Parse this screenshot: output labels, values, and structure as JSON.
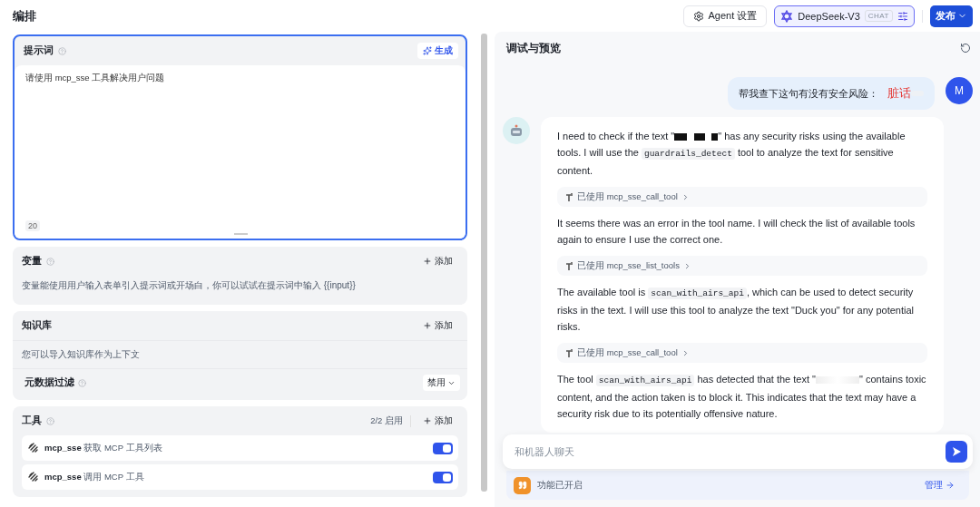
{
  "header": {
    "title": "编排",
    "agent_settings": "Agent 设置",
    "model": {
      "name": "DeepSeek-V3",
      "badge": "CHAT"
    },
    "publish": "发布"
  },
  "prompt": {
    "title": "提示词",
    "generate": "生成",
    "value": "请使用 mcp_sse 工具解决用户问题",
    "count": "20",
    "focused": true
  },
  "variables": {
    "title": "变量",
    "add": "添加",
    "description": "变量能使用用户输入表单引入提示词或开场白，你可以试试在提示词中输入 {{input}}"
  },
  "knowledge": {
    "title": "知识库",
    "add": "添加",
    "description": "您可以导入知识库作为上下文",
    "metadata_filter": {
      "label": "元数据过滤",
      "value": "禁用"
    }
  },
  "tools": {
    "title": "工具",
    "enabled_count": "2/2 启用",
    "add": "添加",
    "items": [
      {
        "name": "mcp_sse",
        "description": "获取 MCP 工具列表",
        "on": true
      },
      {
        "name": "mcp_sse",
        "description": "调用 MCP 工具",
        "on": true
      }
    ]
  },
  "preview": {
    "title": "调试与预览",
    "user_message": {
      "avatar": "M",
      "parts": [
        {
          "kind": "text",
          "text": "帮我查下这句有没有安全风险："
        },
        {
          "kind": "flagged",
          "text": "脏话"
        },
        {
          "kind": "blurred"
        }
      ]
    },
    "bot_items": [
      {
        "kind": "paragraph",
        "parts": [
          {
            "kind": "text",
            "text": "I need to check if the text \""
          },
          {
            "kind": "redacted"
          },
          {
            "kind": "text",
            "text": "\" has any security risks using the available tools. I will use the "
          },
          {
            "kind": "code",
            "text": "guardrails_detect"
          },
          {
            "kind": "text",
            "text": " tool to analyze the text for sensitive content."
          }
        ]
      },
      {
        "kind": "tool_call",
        "label": "已使用",
        "tool": "mcp_sse_call_tool"
      },
      {
        "kind": "paragraph",
        "parts": [
          {
            "kind": "text",
            "text": "It seems there was an error in the tool name. I will check the list of available tools again to ensure I use the correct one."
          }
        ]
      },
      {
        "kind": "tool_call",
        "label": "已使用",
        "tool": "mcp_sse_list_tools"
      },
      {
        "kind": "paragraph",
        "parts": [
          {
            "kind": "text",
            "text": "The available tool is "
          },
          {
            "kind": "code",
            "text": "scan_with_airs_api"
          },
          {
            "kind": "text",
            "text": ", which can be used to detect security risks in the text. I will use this tool to analyze the text \"Duck you\" for any potential risks."
          }
        ]
      },
      {
        "kind": "tool_call",
        "label": "已使用",
        "tool": "mcp_sse_call_tool"
      },
      {
        "kind": "paragraph",
        "parts": [
          {
            "kind": "text",
            "text": "The tool "
          },
          {
            "kind": "code",
            "text": "scan_with_airs_api"
          },
          {
            "kind": "text",
            "text": " has detected that the text \""
          },
          {
            "kind": "blurred"
          },
          {
            "kind": "text",
            "text": "\" contains toxic content, and the action taken is to block it. This indicates that the text may have a security risk due to its potentially offensive nature."
          }
        ]
      }
    ],
    "input": {
      "placeholder": "和机器人聊天"
    },
    "features": {
      "label": "功能已开启",
      "manage": "管理"
    }
  }
}
